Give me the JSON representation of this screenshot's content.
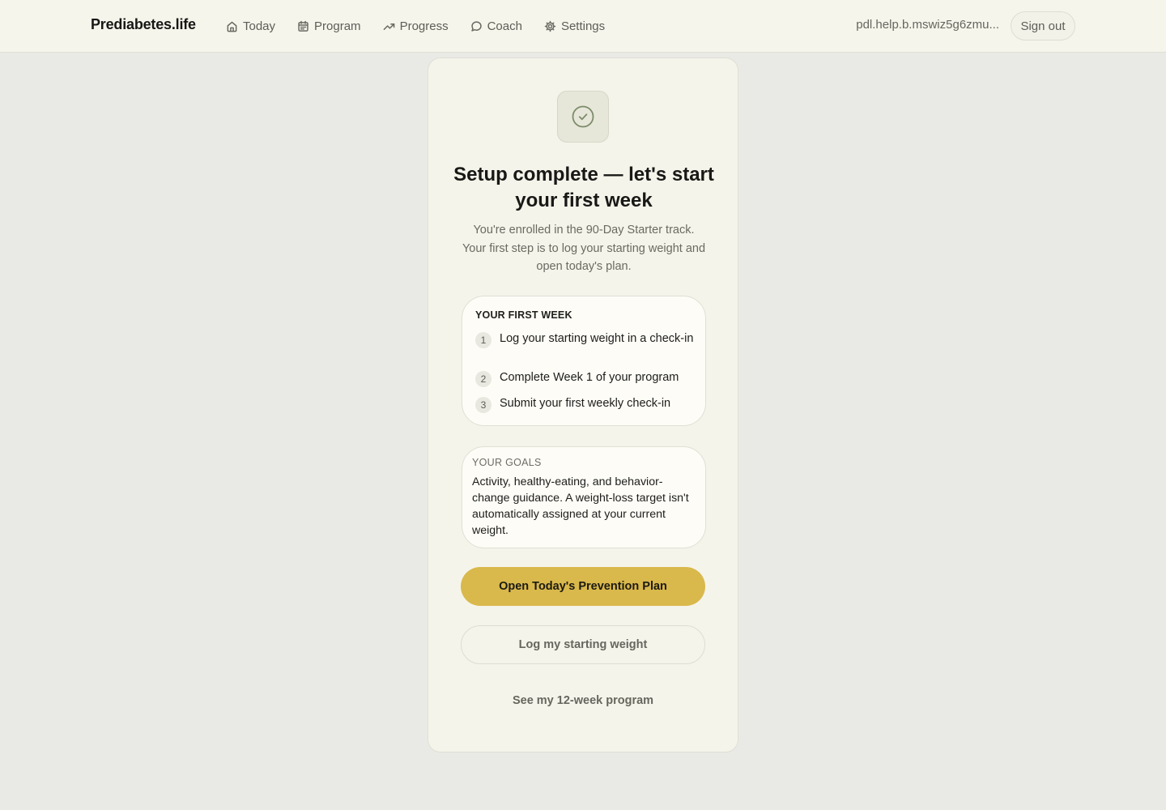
{
  "header": {
    "brand": "Prediabetes.life",
    "nav": [
      {
        "label": "Today",
        "icon": "home-icon"
      },
      {
        "label": "Program",
        "icon": "calendar-icon"
      },
      {
        "label": "Progress",
        "icon": "trending-up-icon"
      },
      {
        "label": "Coach",
        "icon": "chat-bubble-icon"
      },
      {
        "label": "Settings",
        "icon": "gear-icon"
      }
    ],
    "account_email": "pdl.help.b.mswiz5g6zmu...",
    "sign_out_label": "Sign out"
  },
  "card": {
    "icon": "check-circle-icon",
    "title": "Setup complete — let's start your first week",
    "subtitle": "You're enrolled in the 90-Day Starter track. Your first step is to log your starting weight and open today's plan.",
    "first_week": {
      "heading": "YOUR FIRST WEEK",
      "steps": [
        {
          "num": "1",
          "text": "Log your starting weight in a check-in"
        },
        {
          "num": "2",
          "text": "Complete Week 1 of your program"
        },
        {
          "num": "3",
          "text": "Submit your first weekly check-in"
        }
      ]
    },
    "goals": {
      "heading": "YOUR GOALS",
      "text": "Activity, healthy-eating, and behavior-change guidance. A weight-loss target isn't automatically assigned at your current weight."
    },
    "primary_button": "Open Today's Prevention Plan",
    "secondary_button": "Log my starting weight",
    "program_link": "See my 12-week program"
  },
  "colors": {
    "accent": "#d9b84c",
    "background": "#e9eae5",
    "card": "#f5f4ea"
  }
}
